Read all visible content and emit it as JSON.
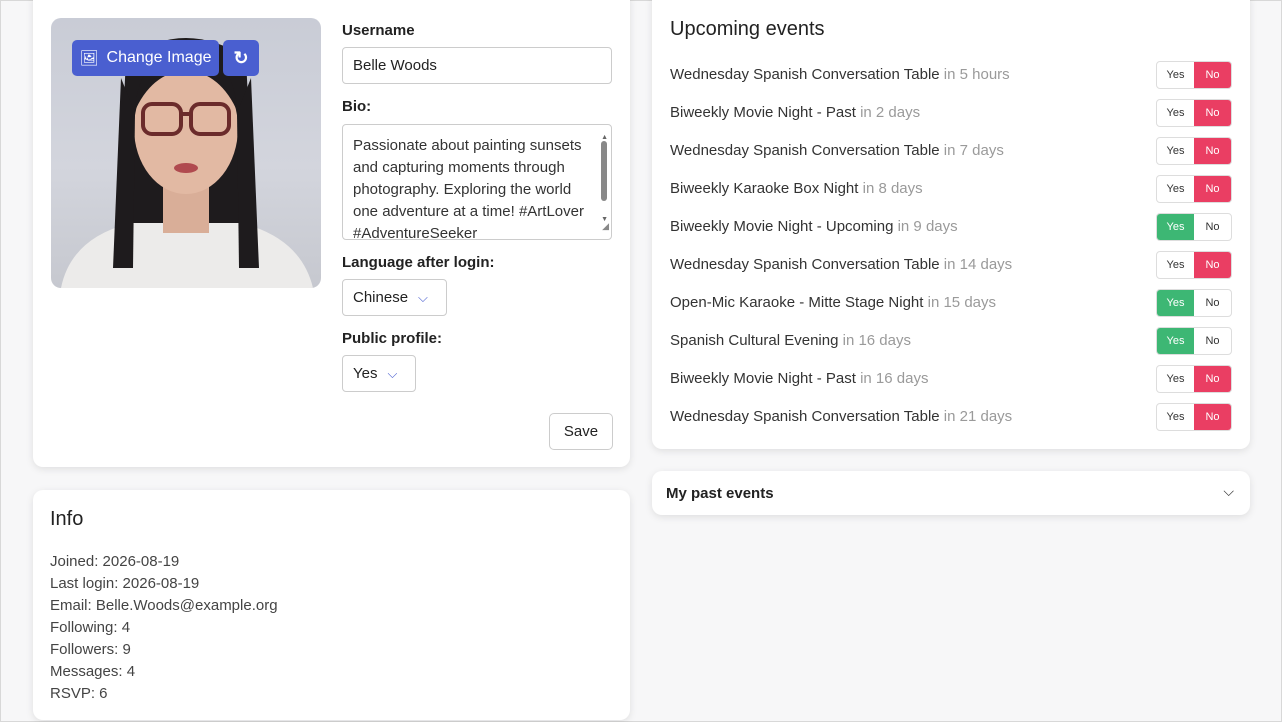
{
  "profile": {
    "change_image_label": "Change Image",
    "username_label": "Username",
    "username_value": "Belle Woods",
    "bio_label": "Bio:",
    "bio_value": "Passionate about painting sunsets and capturing moments through photography. Exploring the world one adventure at a time! #ArtLover #AdventureSeeker",
    "language_label": "Language after login:",
    "language_value": "Chinese",
    "public_label": "Public profile:",
    "public_value": "Yes",
    "save_label": "Save"
  },
  "info": {
    "title": "Info",
    "lines": [
      "Joined: 2026-08-19",
      "Last login: 2026-08-19",
      "Email: Belle.Woods@example.org",
      "Following: 4",
      "Followers: 9",
      "Messages: 4",
      "RSVP: 6"
    ]
  },
  "events": {
    "title": "Upcoming events",
    "yes_label": "Yes",
    "no_label": "No",
    "items": [
      {
        "name": "Wednesday Spanish Conversation Table",
        "when": "in 5 hours",
        "rsvp": "No"
      },
      {
        "name": "Biweekly Movie Night - Past",
        "when": "in 2 days",
        "rsvp": "No"
      },
      {
        "name": "Wednesday Spanish Conversation Table",
        "when": "in 7 days",
        "rsvp": "No"
      },
      {
        "name": "Biweekly Karaoke Box Night",
        "when": "in 8 days",
        "rsvp": "No"
      },
      {
        "name": "Biweekly Movie Night - Upcoming",
        "when": "in 9 days",
        "rsvp": "Yes"
      },
      {
        "name": "Wednesday Spanish Conversation Table",
        "when": "in 14 days",
        "rsvp": "No"
      },
      {
        "name": "Open-Mic Karaoke - Mitte Stage Night",
        "when": "in 15 days",
        "rsvp": "Yes"
      },
      {
        "name": "Spanish Cultural Evening",
        "when": "in 16 days",
        "rsvp": "Yes"
      },
      {
        "name": "Biweekly Movie Night - Past",
        "when": "in 16 days",
        "rsvp": "No"
      },
      {
        "name": "Wednesday Spanish Conversation Table",
        "when": "in 21 days",
        "rsvp": "No"
      }
    ]
  },
  "past_events": {
    "title": "My past events"
  },
  "colors": {
    "accent": "#4a5fd0",
    "yes_on": "#3db774",
    "no_on": "#ea3e63"
  }
}
